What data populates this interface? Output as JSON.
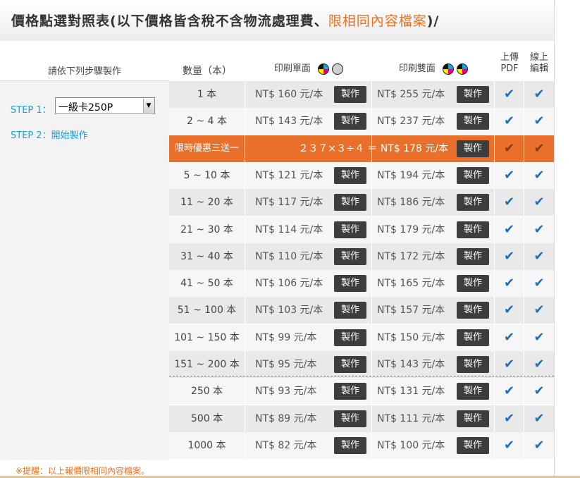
{
  "header": {
    "title_main": "價格點選對照表(以下價格皆含稅不含物流處理費、",
    "title_highlight": "限相同內容檔案",
    "title_tail": ")/"
  },
  "columns": {
    "steps": "請依下列步驟製作",
    "qty": "數量（本）",
    "single": "印刷單面",
    "double": "印刷雙面",
    "upload_line1": "上傳",
    "upload_line2": "PDF",
    "edit_line1": "線上",
    "edit_line2": "編輯"
  },
  "steps": {
    "step1_label": "STEP 1：",
    "step1_select_value": "一級卡250P",
    "step2_label": "STEP 2：",
    "step2_link": "開始製作"
  },
  "button_label": "製作",
  "check_glyph": "✔",
  "rows": [
    {
      "qty": "1 本",
      "single": "NT$ 160 元/本",
      "double": "NT$ 255 元/本"
    },
    {
      "qty": "2 ~ 4 本",
      "single": "NT$ 143 元/本",
      "double": "NT$ 237 元/本"
    },
    {
      "qty": "限時優惠三送一",
      "promo": "２３７×３÷４ ＝ NT$ 178 元/本"
    },
    {
      "qty": "5 ~ 10 本",
      "single": "NT$ 121 元/本",
      "double": "NT$ 194 元/本"
    },
    {
      "qty": "11 ~ 20 本",
      "single": "NT$ 117 元/本",
      "double": "NT$ 186 元/本"
    },
    {
      "qty": "21 ~ 30 本",
      "single": "NT$ 114 元/本",
      "double": "NT$ 179 元/本"
    },
    {
      "qty": "31 ~ 40 本",
      "single": "NT$ 110 元/本",
      "double": "NT$ 172 元/本"
    },
    {
      "qty": "41 ~ 50 本",
      "single": "NT$ 106 元/本",
      "double": "NT$ 165 元/本"
    },
    {
      "qty": "51 ~ 100 本",
      "single": "NT$ 103 元/本",
      "double": "NT$ 157 元/本"
    },
    {
      "qty": "101 ~ 150 本",
      "single": "NT$ 99 元/本",
      "double": "NT$ 150 元/本"
    },
    {
      "qty": "151 ~ 200 本",
      "single": "NT$ 95 元/本",
      "double": "NT$ 143 元/本"
    },
    {
      "qty": "250 本",
      "single": "NT$ 93 元/本",
      "double": "NT$ 131 元/本"
    },
    {
      "qty": "500 本",
      "single": "NT$ 89 元/本",
      "double": "NT$ 111 元/本"
    },
    {
      "qty": "1000 本",
      "single": "NT$ 82 元/本",
      "double": "NT$ 100 元/本"
    }
  ],
  "note": "※提醒：以上報價限相同內容檔案。",
  "colors": {
    "accent": "#e87022",
    "promo_row": "#e8702a",
    "step_blue": "#1aa0d6",
    "check_blue": "#1c6fbf"
  }
}
